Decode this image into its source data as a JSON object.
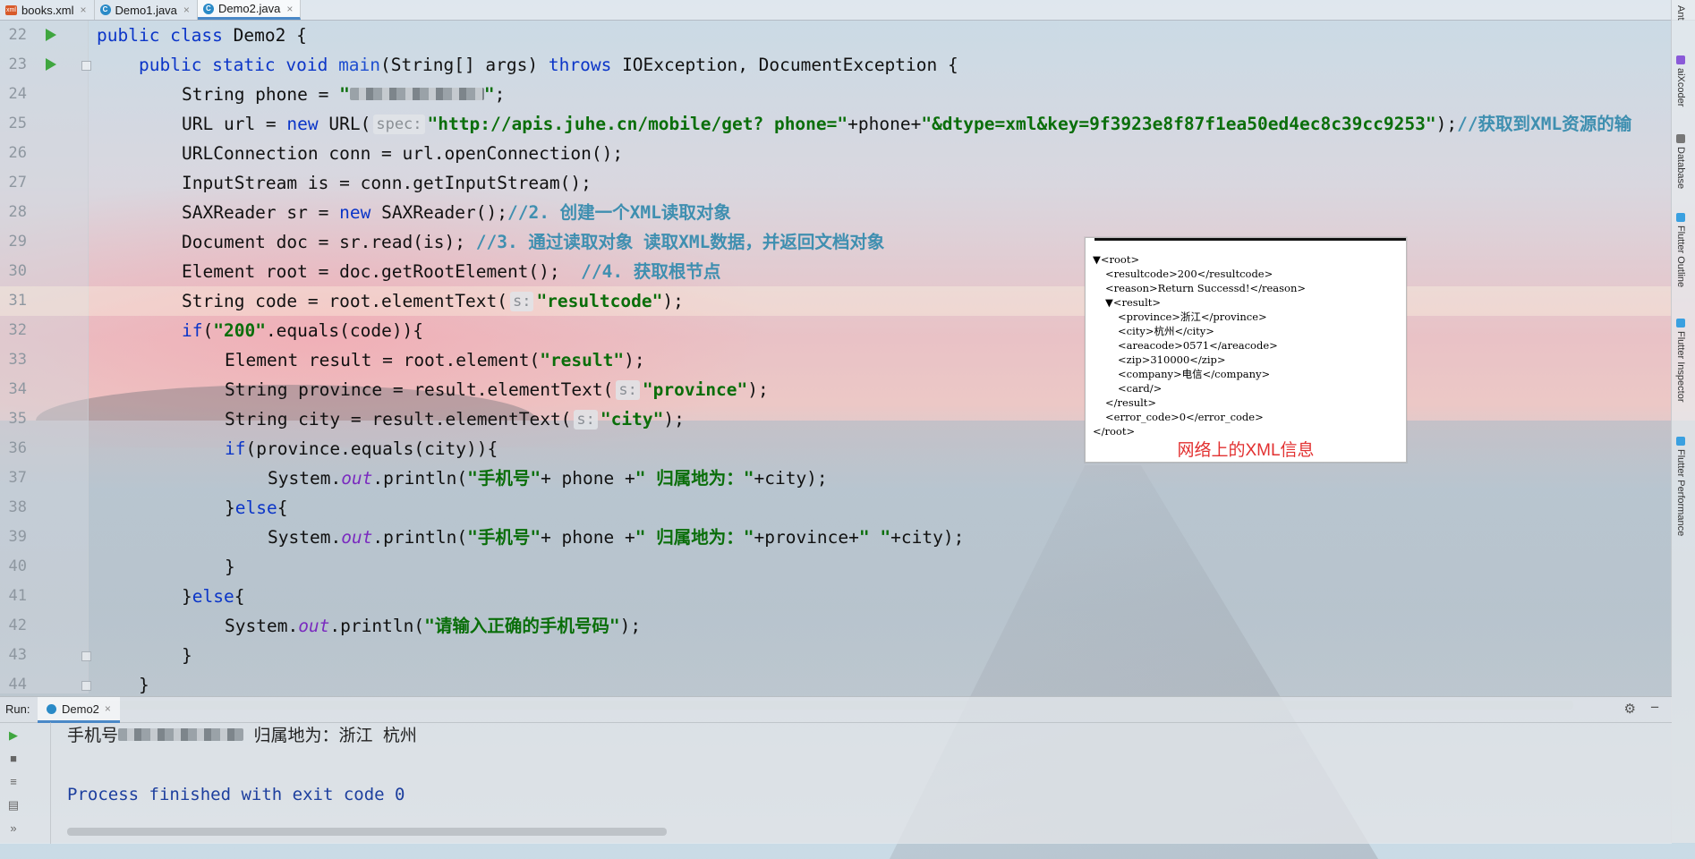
{
  "tabs": [
    {
      "label": "books.xml",
      "icon": "xml-file-icon",
      "active": false
    },
    {
      "label": "Demo1.java",
      "icon": "java-class-icon",
      "active": false
    },
    {
      "label": "Demo2.java",
      "icon": "java-class-icon",
      "active": true
    }
  ],
  "editor": {
    "line_numbers": [
      "22",
      "23",
      "24",
      "25",
      "26",
      "27",
      "28",
      "29",
      "30",
      "31",
      "32",
      "33",
      "34",
      "35",
      "36",
      "37",
      "38",
      "39",
      "40",
      "41",
      "42",
      "43",
      "44"
    ],
    "current_line": "31",
    "hints": {
      "spec": "spec:",
      "s": "s:"
    },
    "code": {
      "l22_a": "public class ",
      "l22_b": "Demo2 {",
      "l23_a": "public static void ",
      "l23_b": "main",
      "l23_c": "(String[] args) ",
      "l23_d": "throws ",
      "l23_e": "IOException, DocumentException {",
      "l24_a": "String phone = ",
      "l24_q1": "\"",
      "l24_q2": "\"",
      "l24_end": ";",
      "l25_a": "URL url = ",
      "l25_new": "new ",
      "l25_b": "URL(",
      "l25_s1": "\"http://apis.juhe.cn/mobile/get? phone=\"",
      "l25_c": "+phone+",
      "l25_s2": "\"&dtype=xml&key=9f3923e8f87f1ea50ed4ec8c39cc9253\"",
      "l25_d": ");",
      "l25_cmt": "//获取到XML资源的输",
      "l26": "URLConnection conn = url.openConnection();",
      "l27": "InputStream is = conn.getInputStream();",
      "l28_a": "SAXReader sr = ",
      "l28_new": "new ",
      "l28_b": "SAXReader();",
      "l28_cmt": "//2. 创建一个XML读取对象",
      "l29_a": "Document doc = sr.read(is); ",
      "l29_cmt": "//3. 通过读取对象 读取XML数据，并返回文档对象",
      "l30_a": "Element root = doc.getRootElement();  ",
      "l30_cmt": "//4. 获取根节点",
      "l31_a": "String code = root.elementText(",
      "l31_s": "\"resultcode\"",
      "l31_b": ");",
      "l32_if": "if",
      "l32_a": "(",
      "l32_s": "\"200\"",
      "l32_b": ".equals(code)){",
      "l33_a": "Element result = root.element(",
      "l33_s": "\"result\"",
      "l33_b": ");",
      "l34_a": "String province = result.elementText(",
      "l34_s": "\"province\"",
      "l34_b": ");",
      "l35_a": "String city = result.elementText(",
      "l35_s": "\"city\"",
      "l35_b": ");",
      "l36_if": "if",
      "l36_a": "(province.equals(city)){",
      "l37_a": "System.",
      "l37_out": "out",
      "l37_b": ".println(",
      "l37_s1": "\"手机号\"",
      "l37_c": "+ phone +",
      "l37_s2": "\" 归属地为：\"",
      "l37_d": "+city);",
      "l38_a": "}",
      "l38_else": "else",
      "l38_b": "{",
      "l39_a": "System.",
      "l39_out": "out",
      "l39_b": ".println(",
      "l39_s1": "\"手机号\"",
      "l39_c": "+ phone +",
      "l39_s2": "\" 归属地为：\"",
      "l39_d": "+province+",
      "l39_s3": "\" \"",
      "l39_e": "+city);",
      "l40": "}",
      "l41_a": "}",
      "l41_else": "else",
      "l41_b": "{",
      "l42_a": "System.",
      "l42_out": "out",
      "l42_b": ".println(",
      "l42_s": "\"请输入正确的手机号码\"",
      "l42_c": ");",
      "l43": "}",
      "l44": "}"
    }
  },
  "xml_popup": {
    "lines": [
      {
        "indent": 0,
        "text": "▼<root>"
      },
      {
        "indent": 1,
        "text": "<resultcode>200</resultcode>"
      },
      {
        "indent": 1,
        "text": "<reason>Return Successd!</reason>"
      },
      {
        "indent": 1,
        "text": "▼<result>"
      },
      {
        "indent": 2,
        "text": "<province>浙江</province>"
      },
      {
        "indent": 2,
        "text": "<city>杭州</city>"
      },
      {
        "indent": 2,
        "text": "<areacode>0571</areacode>"
      },
      {
        "indent": 2,
        "text": "<zip>310000</zip>"
      },
      {
        "indent": 2,
        "text": "<company>电信</company>"
      },
      {
        "indent": 2,
        "text": "<card/>"
      },
      {
        "indent": 1,
        "text": "</result>"
      },
      {
        "indent": 1,
        "text": "<error_code>0</error_code>"
      },
      {
        "indent": 0,
        "text": "</root>"
      }
    ],
    "caption": "网络上的XML信息"
  },
  "right_tools": [
    "Ant",
    "aiXcoder",
    "Database",
    "Flutter Outline",
    "Flutter Inspector",
    "Flutter Performance"
  ],
  "run_panel": {
    "label": "Run:",
    "tab": "Demo2",
    "output_prefix": "手机号",
    "output_suffix": "归属地为：浙江 杭州",
    "exit_message": "Process finished with exit code 0"
  },
  "colors": {
    "keyword": "#0b35c8",
    "string": "#0a6e0a",
    "comment": "#3f8fb0",
    "accent": "#4a88c7",
    "run_green": "#3fa63f",
    "caption_red": "#e23030"
  }
}
